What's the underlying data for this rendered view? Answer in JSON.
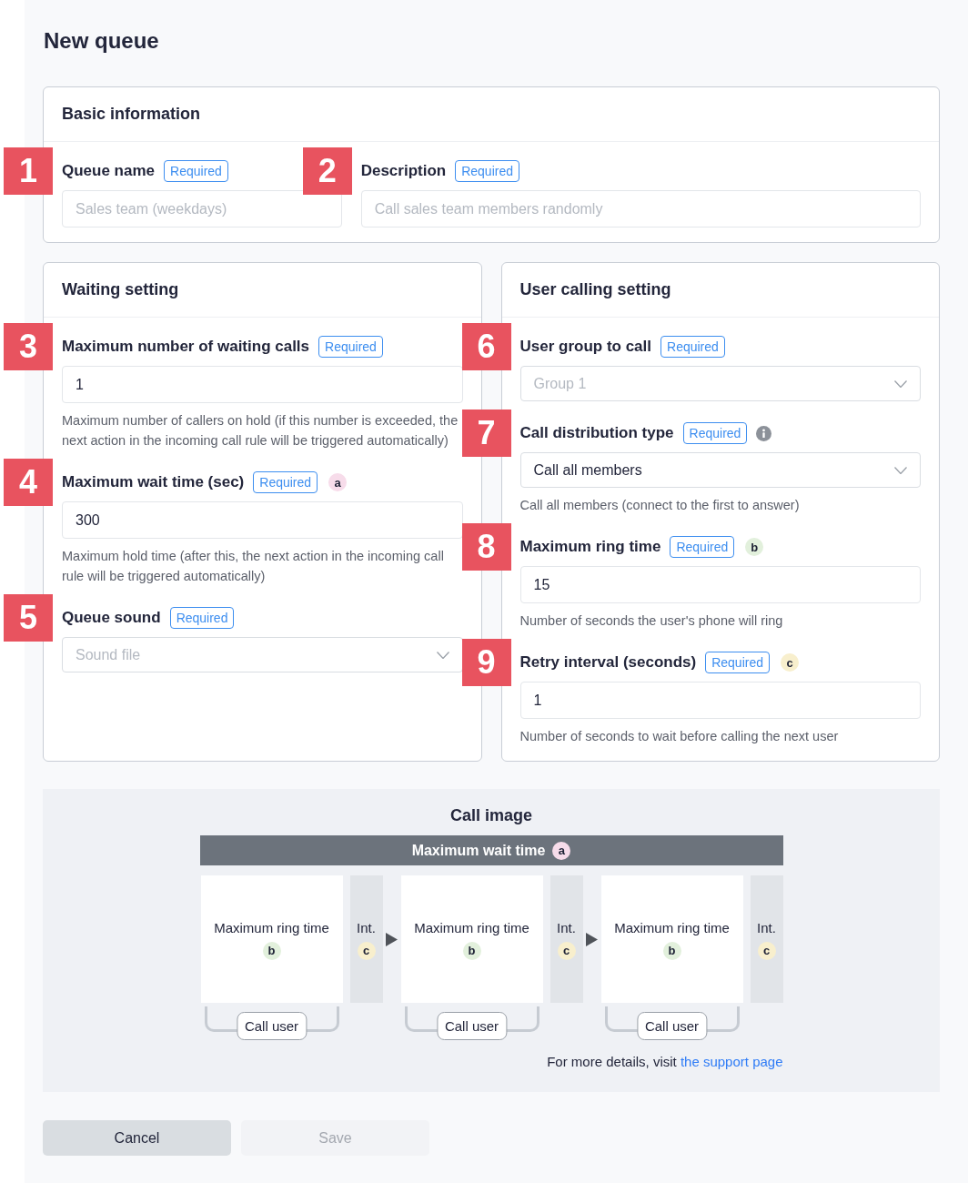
{
  "page": {
    "title": "New queue"
  },
  "basic_information": {
    "title": "Basic information",
    "fields": [
      {
        "number": "1",
        "label": "Queue name",
        "tag": "Required",
        "kind": "input",
        "placeholder": "Sales team (weekdays)",
        "info": false
      },
      {
        "number": "2",
        "label": "Description",
        "tag": "Required",
        "kind": "input",
        "placeholder": "Call sales team members randomly",
        "info": false
      }
    ]
  },
  "settings": [
    {
      "title": "Waiting setting",
      "fields": [
        {
          "number": "3",
          "label": "Maximum number of waiting calls",
          "tag": "Required",
          "kind": "input",
          "value": "1",
          "help": "Maximum number of callers on hold (if this number is exceeded, the next action in the incoming call rule will be triggered automatically)",
          "info": false
        },
        {
          "number": "4",
          "label": "Maximum wait time (sec)",
          "tag": "Required",
          "marker": {
            "text": "a",
            "color": "#f7dcea"
          },
          "kind": "input",
          "value": "300",
          "help": "Maximum hold time (after this, the next action in the incoming call rule will be triggered automatically)",
          "info": false
        },
        {
          "number": "5",
          "label": "Queue sound",
          "tag": "Required",
          "kind": "select",
          "placeholder": "Sound file",
          "info": false
        }
      ]
    },
    {
      "title": "User calling setting",
      "fields": [
        {
          "number": "6",
          "label": "User group to call",
          "tag": "Required",
          "kind": "select",
          "placeholder": "Group 1",
          "info": false
        },
        {
          "number": "7",
          "label": "Call distribution type",
          "tag": "Required",
          "kind": "select",
          "value": "Call all members",
          "help": "Call all members (connect to the first to answer)",
          "info": true
        },
        {
          "number": "8",
          "label": "Maximum ring time",
          "tag": "Required",
          "marker": {
            "text": "b",
            "color": "#e2f0dc"
          },
          "kind": "input",
          "value": "15",
          "help": "Number of seconds the user's phone will ring",
          "info": false
        },
        {
          "number": "9",
          "label": "Retry interval (seconds)",
          "tag": "Required",
          "marker": {
            "text": "c",
            "color": "#f8efcd"
          },
          "kind": "input",
          "value": "1",
          "help": "Number of seconds to wait before calling the next user",
          "info": false
        }
      ]
    }
  ],
  "call_image": {
    "title": "Call image",
    "wait_bar": {
      "label": "Maximum wait time",
      "marker": {
        "text": "a",
        "color": "#f7dcea"
      }
    },
    "steps": [
      {
        "label": "Maximum ring time",
        "marker": {
          "text": "b",
          "color": "#e2f0dc"
        },
        "interval": {
          "label": "Int.",
          "marker": {
            "text": "c",
            "color": "#f8efcd"
          }
        },
        "call_label": "Call user"
      },
      {
        "label": "Maximum ring time",
        "marker": {
          "text": "b",
          "color": "#e2f0dc"
        },
        "interval": {
          "label": "Int.",
          "marker": {
            "text": "c",
            "color": "#f8efcd"
          }
        },
        "call_label": "Call user"
      },
      {
        "label": "Maximum ring time",
        "marker": {
          "text": "b",
          "color": "#e2f0dc"
        },
        "interval": {
          "label": "Int.",
          "marker": {
            "text": "c",
            "color": "#f8efcd"
          }
        },
        "call_label": "Call user"
      }
    ],
    "footer": {
      "text": "For more details, visit",
      "link": "the support page"
    }
  },
  "buttons": [
    {
      "label": "Cancel",
      "disabled": false
    },
    {
      "label": "Save",
      "disabled": true
    }
  ]
}
